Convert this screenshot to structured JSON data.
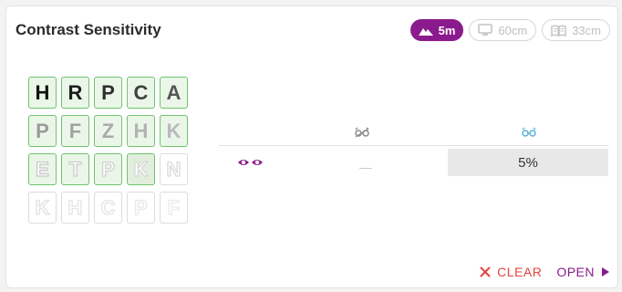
{
  "card": {
    "title": "Contrast Sensitivity"
  },
  "distances": [
    {
      "label": "5m",
      "icon": "mountain-icon",
      "active": true
    },
    {
      "label": "60cm",
      "icon": "monitor-icon",
      "active": false
    },
    {
      "label": "33cm",
      "icon": "book-icon",
      "active": false
    }
  ],
  "chart": {
    "rows": [
      [
        "H",
        "R",
        "P",
        "C",
        "A"
      ],
      [
        "P",
        "F",
        "Z",
        "H",
        "K"
      ],
      [
        "E",
        "T",
        "P",
        "K",
        "N"
      ],
      [
        "K",
        "H",
        "C",
        "P",
        "F"
      ]
    ],
    "selected_through": {
      "row": 2,
      "col": 3
    },
    "highlighted_cell": {
      "row": 2,
      "col": 3
    }
  },
  "results": {
    "columns": [
      {
        "icon": "glasses-crossed-icon",
        "color": "#8a8a8a"
      },
      {
        "icon": "glasses-icon",
        "color": "#5bb1dc"
      }
    ],
    "rows": [
      {
        "icon": "both-eyes-icon",
        "without_correction": "—",
        "with_correction": "5%"
      }
    ]
  },
  "actions": {
    "clear_label": "CLEAR",
    "open_label": "OPEN"
  },
  "colors": {
    "brand": "#8b1a8c",
    "clear": "#e0443e",
    "selected_border": "#6ec46a"
  }
}
